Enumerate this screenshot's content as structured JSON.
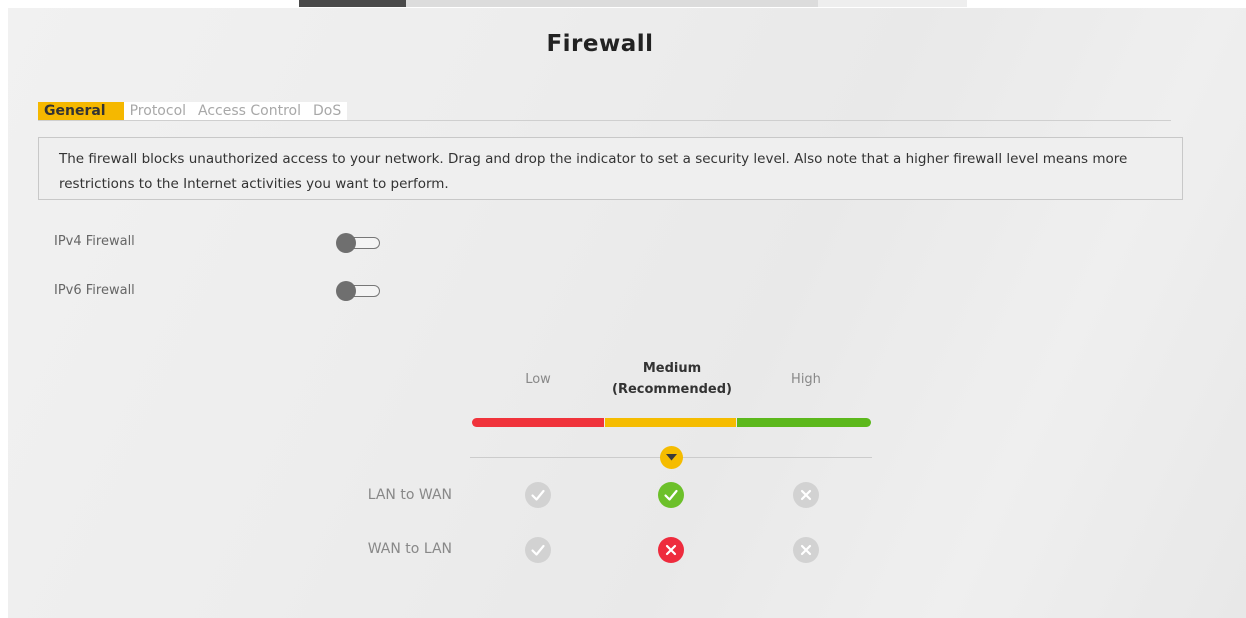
{
  "page": {
    "title": "Firewall"
  },
  "tabs": [
    {
      "label": "General",
      "active": true
    },
    {
      "label": "Protocol",
      "active": false
    },
    {
      "label": "Access Control",
      "active": false
    },
    {
      "label": "DoS",
      "active": false
    }
  ],
  "description": "The firewall blocks unauthorized access to your network. Drag and drop the indicator to set a security level. Also note that a higher firewall level means more restrictions to the Internet activities you want to perform.",
  "settings": [
    {
      "label": "IPv4 Firewall",
      "enabled": false
    },
    {
      "label": "IPv6 Firewall",
      "enabled": false
    }
  ],
  "security_level": {
    "levels": [
      {
        "name": "Low",
        "color": "#f0333b"
      },
      {
        "name": "Medium",
        "note": "(Recommended)",
        "color": "#f5bc00"
      },
      {
        "name": "High",
        "color": "#5cb81c"
      }
    ],
    "selected": "Medium"
  },
  "rules": [
    {
      "label": "LAN to WAN",
      "low": "allowed-inactive",
      "medium": "allowed",
      "high": "blocked-inactive"
    },
    {
      "label": "WAN to LAN",
      "low": "allowed-inactive",
      "medium": "blocked",
      "high": "blocked-inactive"
    }
  ],
  "colors": {
    "accent": "#f5b800",
    "allowed": "#6cc02a",
    "blocked": "#ee2b3d",
    "inactive": "#d2d2d2"
  },
  "icons": {
    "allowed": "check-circle-icon",
    "blocked": "x-circle-icon",
    "indicator": "caret-down-icon"
  }
}
